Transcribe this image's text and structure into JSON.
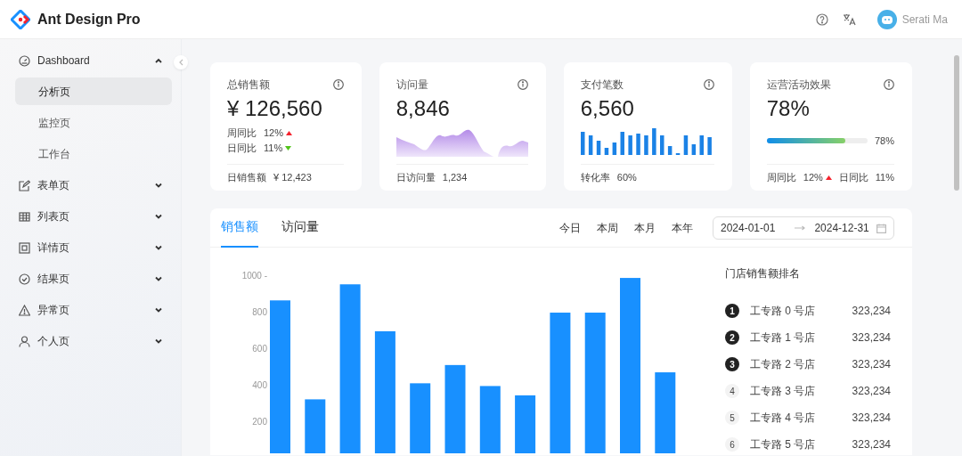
{
  "header": {
    "title": "Ant Design Pro",
    "user": "Serati Ma"
  },
  "sidebar": {
    "items": [
      {
        "label": "Dashboard",
        "expanded": true,
        "children": [
          {
            "label": "分析页",
            "selected": true
          },
          {
            "label": "监控页",
            "selected": false
          },
          {
            "label": "工作台",
            "selected": false
          }
        ]
      },
      {
        "label": "表单页",
        "expanded": false
      },
      {
        "label": "列表页",
        "expanded": false
      },
      {
        "label": "详情页",
        "expanded": false
      },
      {
        "label": "结果页",
        "expanded": false
      },
      {
        "label": "异常页",
        "expanded": false
      },
      {
        "label": "个人页",
        "expanded": false
      }
    ]
  },
  "stat_cards": [
    {
      "kind": "trend",
      "title": "总销售额",
      "value": "¥ 126,560",
      "trends": [
        {
          "label": "周同比",
          "value": "12%",
          "rising": true
        },
        {
          "label": "日同比",
          "value": "11%",
          "rising": false
        }
      ],
      "footer_label": "日销售额",
      "footer_value": "¥ 12,423"
    },
    {
      "kind": "area",
      "title": "访问量",
      "value": "8,846",
      "footer_label": "日访问量",
      "footer_value": "1,234"
    },
    {
      "kind": "bars",
      "title": "支付笔数",
      "value": "6,560",
      "footer_label": "转化率",
      "footer_value": "60%"
    },
    {
      "kind": "progress",
      "title": "运营活动效果",
      "value": "78%",
      "level": 0.78,
      "reading": "78%",
      "trends": [
        {
          "label": "周同比",
          "value": "12%",
          "rising": true
        },
        {
          "label": "日同比",
          "value": "11%"
        }
      ]
    }
  ],
  "sales": {
    "tabs": [
      {
        "label": "销售额",
        "selected": true
      },
      {
        "label": "访问量",
        "selected": false
      }
    ],
    "ranges": [
      "今日",
      "本周",
      "本月",
      "本年"
    ],
    "date_range": {
      "start": "2024-01-01",
      "end": "2024-12-31"
    },
    "chart_data": {
      "type": "bar",
      "ylim": [
        0,
        1000
      ],
      "categories": [
        null,
        null,
        null,
        null,
        null,
        null,
        null,
        null,
        null,
        null,
        null,
        null
      ],
      "yticks": [
        {
          "value": 200,
          "label": "200"
        },
        {
          "value": 400,
          "label": "400"
        },
        {
          "value": 600,
          "label": "600"
        },
        {
          "value": 800,
          "label": "800"
        },
        {
          "value": 1000,
          "label": "1000 -"
        }
      ],
      "series": [
        {
          "color": "#1890ff",
          "values": [
            862,
            320,
            950,
            693,
            408,
            508,
            393,
            342,
            795,
            795,
            985,
            468
          ]
        }
      ]
    },
    "ranking": {
      "title": "门店销售额排名",
      "rows": [
        {
          "rank": "1",
          "name": "工专路 0 号店",
          "value": "323,234",
          "highlighted": true
        },
        {
          "rank": "2",
          "name": "工专路 1 号店",
          "value": "323,234",
          "highlighted": true
        },
        {
          "rank": "3",
          "name": "工专路 2 号店",
          "value": "323,234",
          "highlighted": true
        },
        {
          "rank": "4",
          "name": "工专路 3 号店",
          "value": "323,234",
          "highlighted": false
        },
        {
          "rank": "5",
          "name": "工专路 4 号店",
          "value": "323,234",
          "highlighted": false
        },
        {
          "rank": "6",
          "name": "工专路 5 号店",
          "value": "323,234",
          "highlighted": false
        }
      ]
    }
  }
}
